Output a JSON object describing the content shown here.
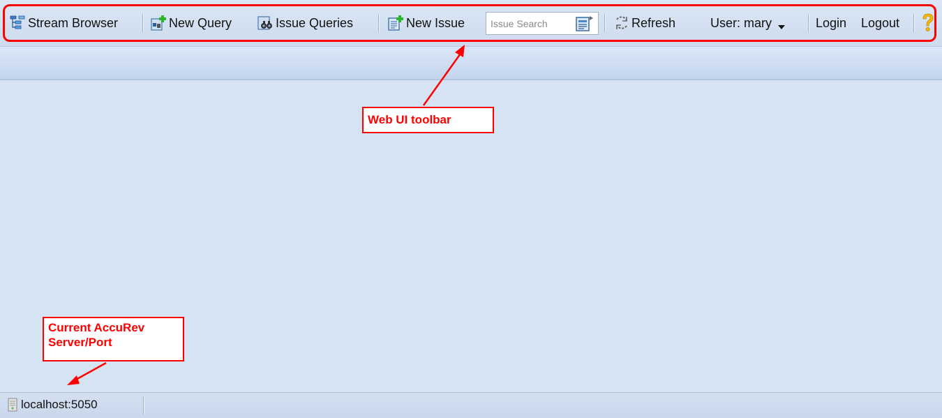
{
  "toolbar": {
    "stream_browser": "Stream Browser",
    "new_query": "New Query",
    "issue_queries": "Issue Queries",
    "new_issue": "New Issue",
    "search_placeholder": "Issue Search",
    "refresh": "Refresh",
    "user": "User: mary",
    "login": "Login",
    "logout": "Logout"
  },
  "statusbar": {
    "server": "localhost:5050"
  },
  "annotations": {
    "toolbar_label": "Web UI toolbar",
    "server_label_line1": "Current AccuRev",
    "server_label_line2": "Server/Port"
  },
  "icons": {
    "stream_browser": "stream-tree-icon",
    "new_query": "new-query-icon",
    "issue_queries": "binoculars-icon",
    "new_issue": "new-issue-icon",
    "search": "search-icon",
    "refresh": "refresh-icon",
    "user_menu": "chevron-down-icon",
    "help": "help-icon",
    "server": "server-icon"
  },
  "colors": {
    "annotation": "#ff0000",
    "background": "#d6e3f3",
    "help_icon": "#f5b800"
  }
}
